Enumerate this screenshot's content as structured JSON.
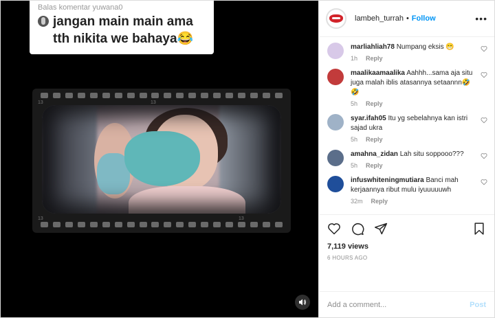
{
  "video": {
    "overlay_reply_to": "Balas komentar yuwana0",
    "overlay_text": "jangan main main ama tth nikita we bahaya😂",
    "film_numbers": [
      "13",
      "13",
      "13",
      "13"
    ],
    "sound_icon": "speaker-icon"
  },
  "header": {
    "username": "lambeh_turrah",
    "separator": "•",
    "follow_label": "Follow",
    "more_label": "•••"
  },
  "comments": [
    {
      "user": "marliahliah78",
      "text": "Numpang eksis 😁",
      "age": "1h",
      "reply": "Reply",
      "avatar_color": "#d8c9e8"
    },
    {
      "user": "maalikaamaalika",
      "text": "Aahhh...sama aja situ juga malah iblis atasannya setaannn🤣🤣",
      "age": "5h",
      "reply": "Reply",
      "avatar_color": "#c23b3b"
    },
    {
      "user": "syar.ifah05",
      "text": "Itu yg sebelahnya kan istri sajad ukra",
      "age": "5h",
      "reply": "Reply",
      "avatar_color": "#9fb2c7"
    },
    {
      "user": "amahna_zidan",
      "text": "Lah situ soppooo???",
      "age": "5h",
      "reply": "Reply",
      "avatar_color": "#5b6e8a"
    },
    {
      "user": "infuswhiteningmutiara",
      "text": "Banci mah kerjaannya ribut mulu iyuuuuuwh",
      "age": "32m",
      "reply": "Reply",
      "avatar_color": "#1f4e9a"
    }
  ],
  "actions": {
    "like_icon": "heart-icon",
    "comment_icon": "comment-icon",
    "share_icon": "share-icon",
    "save_icon": "bookmark-icon",
    "views": "7,119 views",
    "time": "6 HOURS AGO"
  },
  "composer": {
    "placeholder": "Add a comment...",
    "post_label": "Post"
  }
}
